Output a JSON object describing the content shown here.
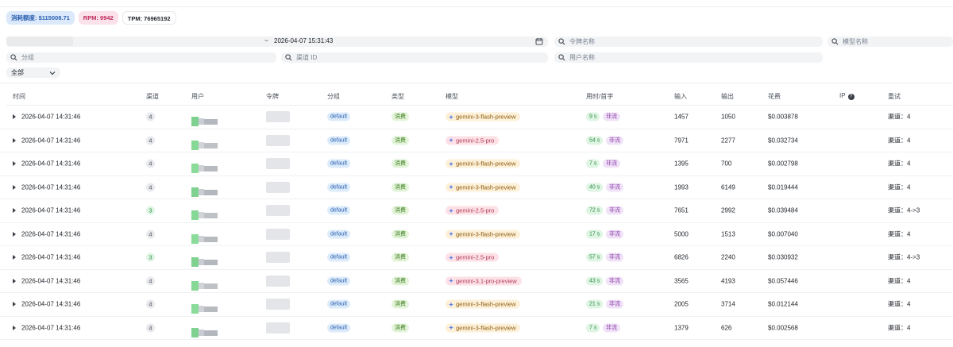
{
  "stats": {
    "quota": "消耗额度: $115008.71",
    "rpm": "RPM: 9942",
    "tpm": "TPM: 76965192"
  },
  "filters": {
    "date_separator": "~",
    "end_time": "2026-04-07 15:31:43",
    "token_placeholder": "令牌名称",
    "model_placeholder": "模型名称",
    "group_placeholder": "分组",
    "channel_placeholder": "渠道 ID",
    "user_placeholder": "用户名称",
    "type_select": "全部"
  },
  "columns": [
    "时间",
    "渠道",
    "用户",
    "令牌",
    "分组",
    "类型",
    "模型",
    "用时/首字",
    "输入",
    "输出",
    "花费",
    "IP",
    "重试"
  ],
  "rows": [
    {
      "time": "2026-04-07 14:31:46",
      "channel": "4",
      "group": "default",
      "type": "消费",
      "model": "gemini-3-flash-preview",
      "duration": "9 s",
      "stream": "非流",
      "input": "1457",
      "output": "1050",
      "cost": "$0.003878",
      "retry": "渠道：4"
    },
    {
      "time": "2026-04-07 14:31:46",
      "channel": "4",
      "group": "default",
      "type": "消费",
      "model": "gemini-2.5-pro",
      "duration": "54 s",
      "stream": "非流",
      "input": "7971",
      "output": "2277",
      "cost": "$0.032734",
      "retry": "渠道：4"
    },
    {
      "time": "2026-04-07 14:31:46",
      "channel": "4",
      "group": "default",
      "type": "消费",
      "model": "gemini-3-flash-preview",
      "duration": "7 s",
      "stream": "非流",
      "input": "1395",
      "output": "700",
      "cost": "$0.002798",
      "retry": "渠道：4"
    },
    {
      "time": "2026-04-07 14:31:46",
      "channel": "4",
      "group": "default",
      "type": "消费",
      "model": "gemini-3-flash-preview",
      "duration": "40 s",
      "stream": "非流",
      "input": "1993",
      "output": "6149",
      "cost": "$0.019444",
      "retry": "渠道：4"
    },
    {
      "time": "2026-04-07 14:31:46",
      "channel": "3",
      "group": "default",
      "type": "消费",
      "model": "gemini-2.5-pro",
      "duration": "72 s",
      "stream": "非流",
      "input": "7651",
      "output": "2992",
      "cost": "$0.039484",
      "retry": "渠道：4->3"
    },
    {
      "time": "2026-04-07 14:31:46",
      "channel": "4",
      "group": "default",
      "type": "消费",
      "model": "gemini-3-flash-preview",
      "duration": "17 s",
      "stream": "非流",
      "input": "5000",
      "output": "1513",
      "cost": "$0.007040",
      "retry": "渠道：4"
    },
    {
      "time": "2026-04-07 14:31:46",
      "channel": "3",
      "group": "default",
      "type": "消费",
      "model": "gemini-2.5-pro",
      "duration": "57 s",
      "stream": "非流",
      "input": "6826",
      "output": "2240",
      "cost": "$0.030932",
      "retry": "渠道：4->3"
    },
    {
      "time": "2026-04-07 14:31:46",
      "channel": "4",
      "group": "default",
      "type": "消费",
      "model": "gemini-3.1-pro-preview",
      "duration": "43 s",
      "stream": "非流",
      "input": "3565",
      "output": "4193",
      "cost": "$0.057446",
      "retry": "渠道：4"
    },
    {
      "time": "2026-04-07 14:31:46",
      "channel": "4",
      "group": "default",
      "type": "消费",
      "model": "gemini-3-flash-preview",
      "duration": "21 s",
      "stream": "非流",
      "input": "2005",
      "output": "3714",
      "cost": "$0.012144",
      "retry": "渠道：4"
    },
    {
      "time": "2026-04-07 14:31:46",
      "channel": "4",
      "group": "default",
      "type": "消费",
      "model": "gemini-3-flash-preview",
      "duration": "7 s",
      "stream": "非流",
      "input": "1379",
      "output": "626",
      "cost": "$0.002568",
      "retry": "渠道：4"
    }
  ],
  "colors": {
    "quota_badge": "#dbe9fb",
    "rpm_badge": "#fbe1ea",
    "channel_green": "#dff5e3",
    "model_flash": "#fdf0d9",
    "model_pro": "#fce1e7",
    "stream_badge": "#f0e2f7"
  },
  "icons": {
    "search": "search-icon",
    "calendar": "calendar-icon",
    "chevron": "chevron-down-icon",
    "expand": "expand-caret-icon",
    "help": "help-circle-icon",
    "model": "sparkle-icon"
  }
}
